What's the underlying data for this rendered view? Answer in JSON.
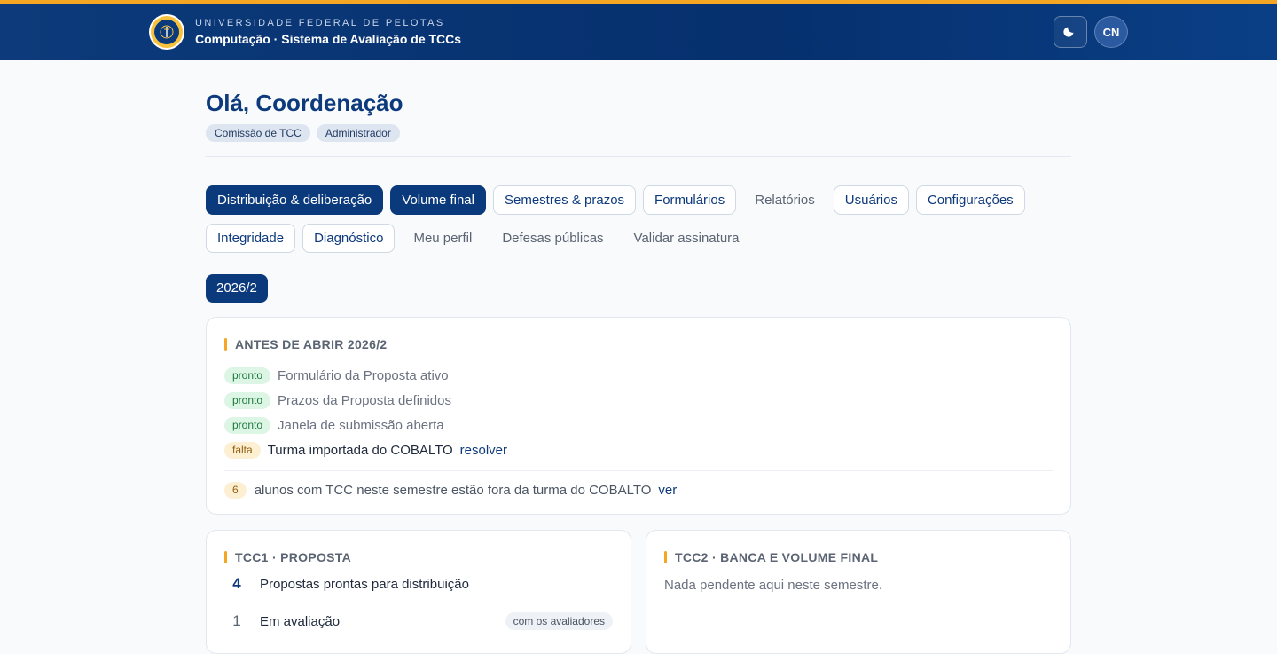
{
  "header": {
    "institution": "UNIVERSIDADE FEDERAL DE PELOTAS",
    "system_title": "Computação · Sistema de Avaliação de TCCs",
    "avatar_initials": "CN",
    "theme_toggle_icon": "moon-icon",
    "logo_icon": "university-seal-icon",
    "colors": {
      "bar": "#06306e",
      "accent": "#f5a623"
    }
  },
  "greeting": "Olá, Coordenação",
  "roles": [
    "Comissão de TCC",
    "Administrador"
  ],
  "tabs": [
    {
      "label": "Distribuição & deliberação",
      "style": "filled"
    },
    {
      "label": "Volume final",
      "style": "filled"
    },
    {
      "label": "Semestres & prazos",
      "style": "outline"
    },
    {
      "label": "Formulários",
      "style": "outline"
    },
    {
      "label": "Relatórios",
      "style": "plain"
    },
    {
      "label": "Usuários",
      "style": "outline"
    },
    {
      "label": "Configurações",
      "style": "outline"
    },
    {
      "label": "Integridade",
      "style": "outline"
    },
    {
      "label": "Diagnóstico",
      "style": "outline"
    },
    {
      "label": "Meu perfil",
      "style": "plain"
    },
    {
      "label": "Defesas públicas",
      "style": "plain"
    },
    {
      "label": "Validar assinatura",
      "style": "plain"
    }
  ],
  "semester": "2026/2",
  "checklist_card": {
    "title": "ANTES DE ABRIR 2026/2",
    "items": [
      {
        "status": "pronto",
        "text": "Formulário da Proposta ativo"
      },
      {
        "status": "pronto",
        "text": "Prazos da Proposta definidos"
      },
      {
        "status": "pronto",
        "text": "Janela de submissão aberta"
      },
      {
        "status": "falta",
        "text": "Turma importada do COBALTO",
        "action": "resolver"
      }
    ],
    "note": {
      "count": "6",
      "text": "alunos com TCC neste semestre estão fora da turma do COBALTO",
      "action": "ver"
    }
  },
  "tcc1_card": {
    "title": "TCC1 · PROPOSTA",
    "rows": [
      {
        "count": "4",
        "label": "Propostas prontas para distribuição"
      },
      {
        "count": "1",
        "label": "Em avaliação",
        "chip": "com os avaliadores"
      }
    ]
  },
  "tcc2_card": {
    "title": "TCC2 · BANCA E VOLUME FINAL",
    "empty_text": "Nada pendente aqui neste semestre."
  }
}
